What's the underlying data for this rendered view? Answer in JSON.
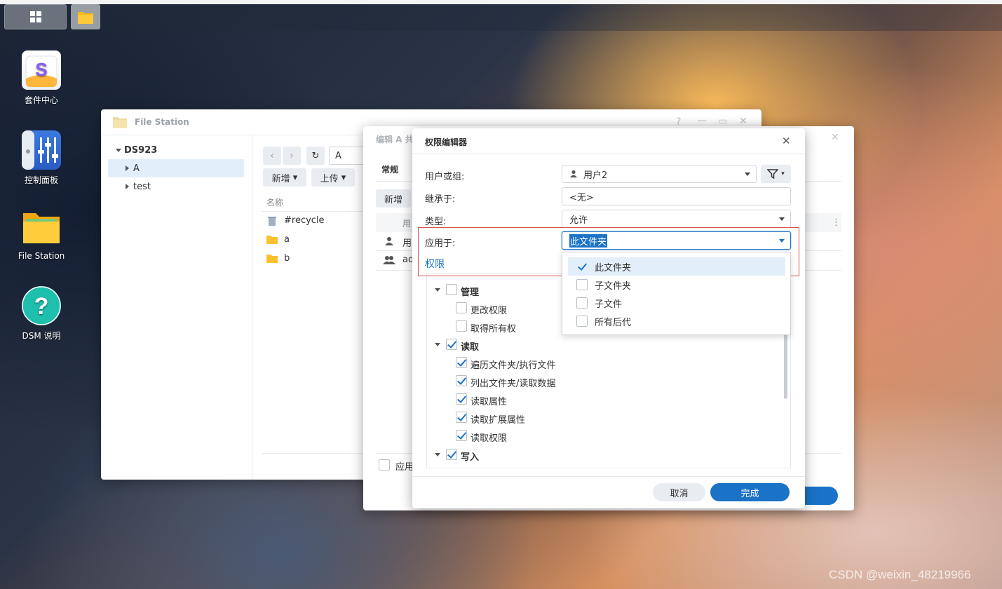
{
  "desktop": {
    "icons": [
      {
        "label": "套件中心"
      },
      {
        "label": "控制面板"
      },
      {
        "label": "File Station"
      },
      {
        "label": "DSM 说明"
      }
    ]
  },
  "file_station": {
    "title": "File Station",
    "tree_root": "DS923",
    "tree_items": [
      "A",
      "test"
    ],
    "path_value": "A",
    "toolbar": {
      "new_label": "新增",
      "upload_label": "上传"
    },
    "column_name": "名称",
    "files": [
      "#recycle",
      "a",
      "b"
    ]
  },
  "edit_dialog": {
    "title": "编辑 A 共",
    "tab_general": "常规",
    "new_button": "新增",
    "col_user": "用",
    "rows": [
      "用",
      "ad"
    ],
    "apply_label": "应用"
  },
  "permission_editor": {
    "title": "权限编辑器",
    "user_label": "用户或组:",
    "user_value": "用户2",
    "inherit_label": "继承于:",
    "inherit_value": "<无>",
    "type_label": "类型:",
    "type_value": "允许",
    "apply_label": "应用于:",
    "apply_value": "此文件夹",
    "permissions_heading": "权限",
    "apply_options": [
      {
        "label": "此文件夹",
        "checked": true
      },
      {
        "label": "子文件夹",
        "checked": false
      },
      {
        "label": "子文件",
        "checked": false
      },
      {
        "label": "所有后代",
        "checked": false
      }
    ],
    "groups": {
      "manage": {
        "label": "管理",
        "checked": false,
        "items": [
          {
            "label": "更改权限",
            "checked": false
          },
          {
            "label": "取得所有权",
            "checked": false
          }
        ]
      },
      "read": {
        "label": "读取",
        "checked": true,
        "items": [
          {
            "label": "遍历文件夹/执行文件",
            "checked": true
          },
          {
            "label": "列出文件夹/读取数据",
            "checked": true
          },
          {
            "label": "读取属性",
            "checked": true
          },
          {
            "label": "读取扩展属性",
            "checked": true
          },
          {
            "label": "读取权限",
            "checked": true
          }
        ]
      },
      "write": {
        "label": "写入",
        "checked": true
      }
    },
    "cancel_label": "取消",
    "done_label": "完成"
  },
  "watermark": "CSDN @weixin_48219966",
  "colors": {
    "accent": "#1a73c7",
    "highlight_border": "#d9534f",
    "selection": "#e3eefb"
  }
}
